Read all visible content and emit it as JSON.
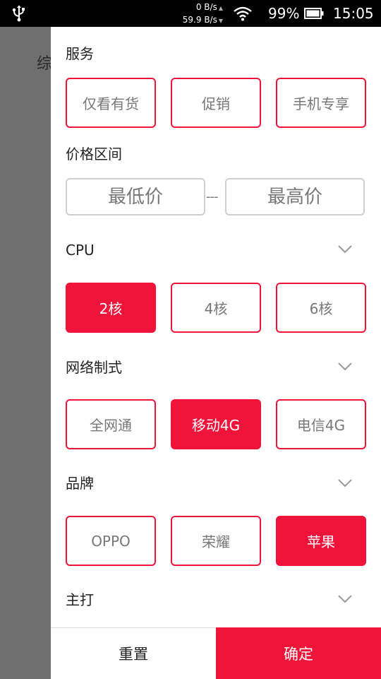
{
  "status_bar": {
    "speed_up": "0 B/s",
    "speed_down": "59.9 B/s",
    "battery": "99%",
    "time": "15:05",
    "icons": [
      "usb-icon",
      "wifi-icon",
      "battery-icon"
    ]
  },
  "backdrop": {
    "visible_text": "综"
  },
  "filter": {
    "service": {
      "title": "服务",
      "options": [
        {
          "label": "仅看有货",
          "selected": false
        },
        {
          "label": "促销",
          "selected": false
        },
        {
          "label": "手机专享",
          "selected": false
        }
      ]
    },
    "price": {
      "title": "价格区间",
      "min_placeholder": "最低价",
      "max_placeholder": "最高价",
      "separator": "---"
    },
    "cpu": {
      "title": "CPU",
      "options": [
        {
          "label": "2核",
          "selected": true
        },
        {
          "label": "4核",
          "selected": false
        },
        {
          "label": "6核",
          "selected": false
        }
      ]
    },
    "network": {
      "title": "网络制式",
      "options": [
        {
          "label": "全网通",
          "selected": false
        },
        {
          "label": "移动4G",
          "selected": true
        },
        {
          "label": "电信4G",
          "selected": false
        }
      ]
    },
    "brand": {
      "title": "品牌",
      "options": [
        {
          "label": "OPPO",
          "selected": false
        },
        {
          "label": "荣耀",
          "selected": false
        },
        {
          "label": "苹果",
          "selected": true
        }
      ]
    },
    "main": {
      "title": "主打"
    }
  },
  "actions": {
    "reset": "重置",
    "confirm": "确定"
  },
  "colors": {
    "accent": "#f0143a",
    "overlay": "#6f6f6f",
    "status_bar": "#000000"
  }
}
